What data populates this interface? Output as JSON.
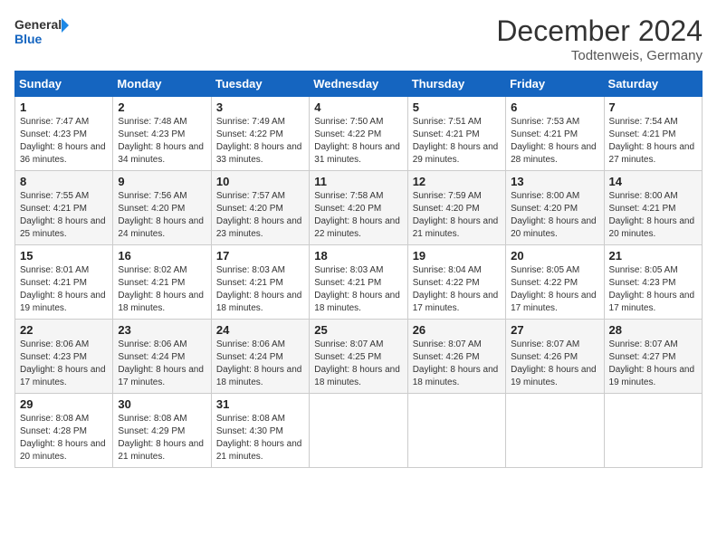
{
  "logo": {
    "line1": "General",
    "line2": "Blue"
  },
  "header": {
    "month": "December 2024",
    "location": "Todtenweis, Germany"
  },
  "weekdays": [
    "Sunday",
    "Monday",
    "Tuesday",
    "Wednesday",
    "Thursday",
    "Friday",
    "Saturday"
  ],
  "weeks": [
    [
      {
        "day": "1",
        "sunrise": "7:47 AM",
        "sunset": "4:23 PM",
        "daylight": "8 hours and 36 minutes."
      },
      {
        "day": "2",
        "sunrise": "7:48 AM",
        "sunset": "4:23 PM",
        "daylight": "8 hours and 34 minutes."
      },
      {
        "day": "3",
        "sunrise": "7:49 AM",
        "sunset": "4:22 PM",
        "daylight": "8 hours and 33 minutes."
      },
      {
        "day": "4",
        "sunrise": "7:50 AM",
        "sunset": "4:22 PM",
        "daylight": "8 hours and 31 minutes."
      },
      {
        "day": "5",
        "sunrise": "7:51 AM",
        "sunset": "4:21 PM",
        "daylight": "8 hours and 29 minutes."
      },
      {
        "day": "6",
        "sunrise": "7:53 AM",
        "sunset": "4:21 PM",
        "daylight": "8 hours and 28 minutes."
      },
      {
        "day": "7",
        "sunrise": "7:54 AM",
        "sunset": "4:21 PM",
        "daylight": "8 hours and 27 minutes."
      }
    ],
    [
      {
        "day": "8",
        "sunrise": "7:55 AM",
        "sunset": "4:21 PM",
        "daylight": "8 hours and 25 minutes."
      },
      {
        "day": "9",
        "sunrise": "7:56 AM",
        "sunset": "4:20 PM",
        "daylight": "8 hours and 24 minutes."
      },
      {
        "day": "10",
        "sunrise": "7:57 AM",
        "sunset": "4:20 PM",
        "daylight": "8 hours and 23 minutes."
      },
      {
        "day": "11",
        "sunrise": "7:58 AM",
        "sunset": "4:20 PM",
        "daylight": "8 hours and 22 minutes."
      },
      {
        "day": "12",
        "sunrise": "7:59 AM",
        "sunset": "4:20 PM",
        "daylight": "8 hours and 21 minutes."
      },
      {
        "day": "13",
        "sunrise": "8:00 AM",
        "sunset": "4:20 PM",
        "daylight": "8 hours and 20 minutes."
      },
      {
        "day": "14",
        "sunrise": "8:00 AM",
        "sunset": "4:21 PM",
        "daylight": "8 hours and 20 minutes."
      }
    ],
    [
      {
        "day": "15",
        "sunrise": "8:01 AM",
        "sunset": "4:21 PM",
        "daylight": "8 hours and 19 minutes."
      },
      {
        "day": "16",
        "sunrise": "8:02 AM",
        "sunset": "4:21 PM",
        "daylight": "8 hours and 18 minutes."
      },
      {
        "day": "17",
        "sunrise": "8:03 AM",
        "sunset": "4:21 PM",
        "daylight": "8 hours and 18 minutes."
      },
      {
        "day": "18",
        "sunrise": "8:03 AM",
        "sunset": "4:21 PM",
        "daylight": "8 hours and 18 minutes."
      },
      {
        "day": "19",
        "sunrise": "8:04 AM",
        "sunset": "4:22 PM",
        "daylight": "8 hours and 17 minutes."
      },
      {
        "day": "20",
        "sunrise": "8:05 AM",
        "sunset": "4:22 PM",
        "daylight": "8 hours and 17 minutes."
      },
      {
        "day": "21",
        "sunrise": "8:05 AM",
        "sunset": "4:23 PM",
        "daylight": "8 hours and 17 minutes."
      }
    ],
    [
      {
        "day": "22",
        "sunrise": "8:06 AM",
        "sunset": "4:23 PM",
        "daylight": "8 hours and 17 minutes."
      },
      {
        "day": "23",
        "sunrise": "8:06 AM",
        "sunset": "4:24 PM",
        "daylight": "8 hours and 17 minutes."
      },
      {
        "day": "24",
        "sunrise": "8:06 AM",
        "sunset": "4:24 PM",
        "daylight": "8 hours and 18 minutes."
      },
      {
        "day": "25",
        "sunrise": "8:07 AM",
        "sunset": "4:25 PM",
        "daylight": "8 hours and 18 minutes."
      },
      {
        "day": "26",
        "sunrise": "8:07 AM",
        "sunset": "4:26 PM",
        "daylight": "8 hours and 18 minutes."
      },
      {
        "day": "27",
        "sunrise": "8:07 AM",
        "sunset": "4:26 PM",
        "daylight": "8 hours and 19 minutes."
      },
      {
        "day": "28",
        "sunrise": "8:07 AM",
        "sunset": "4:27 PM",
        "daylight": "8 hours and 19 minutes."
      }
    ],
    [
      {
        "day": "29",
        "sunrise": "8:08 AM",
        "sunset": "4:28 PM",
        "daylight": "8 hours and 20 minutes."
      },
      {
        "day": "30",
        "sunrise": "8:08 AM",
        "sunset": "4:29 PM",
        "daylight": "8 hours and 21 minutes."
      },
      {
        "day": "31",
        "sunrise": "8:08 AM",
        "sunset": "4:30 PM",
        "daylight": "8 hours and 21 minutes."
      },
      null,
      null,
      null,
      null
    ]
  ],
  "labels": {
    "sunrise_prefix": "Sunrise: ",
    "sunset_prefix": "Sunset: ",
    "daylight_prefix": "Daylight: "
  }
}
